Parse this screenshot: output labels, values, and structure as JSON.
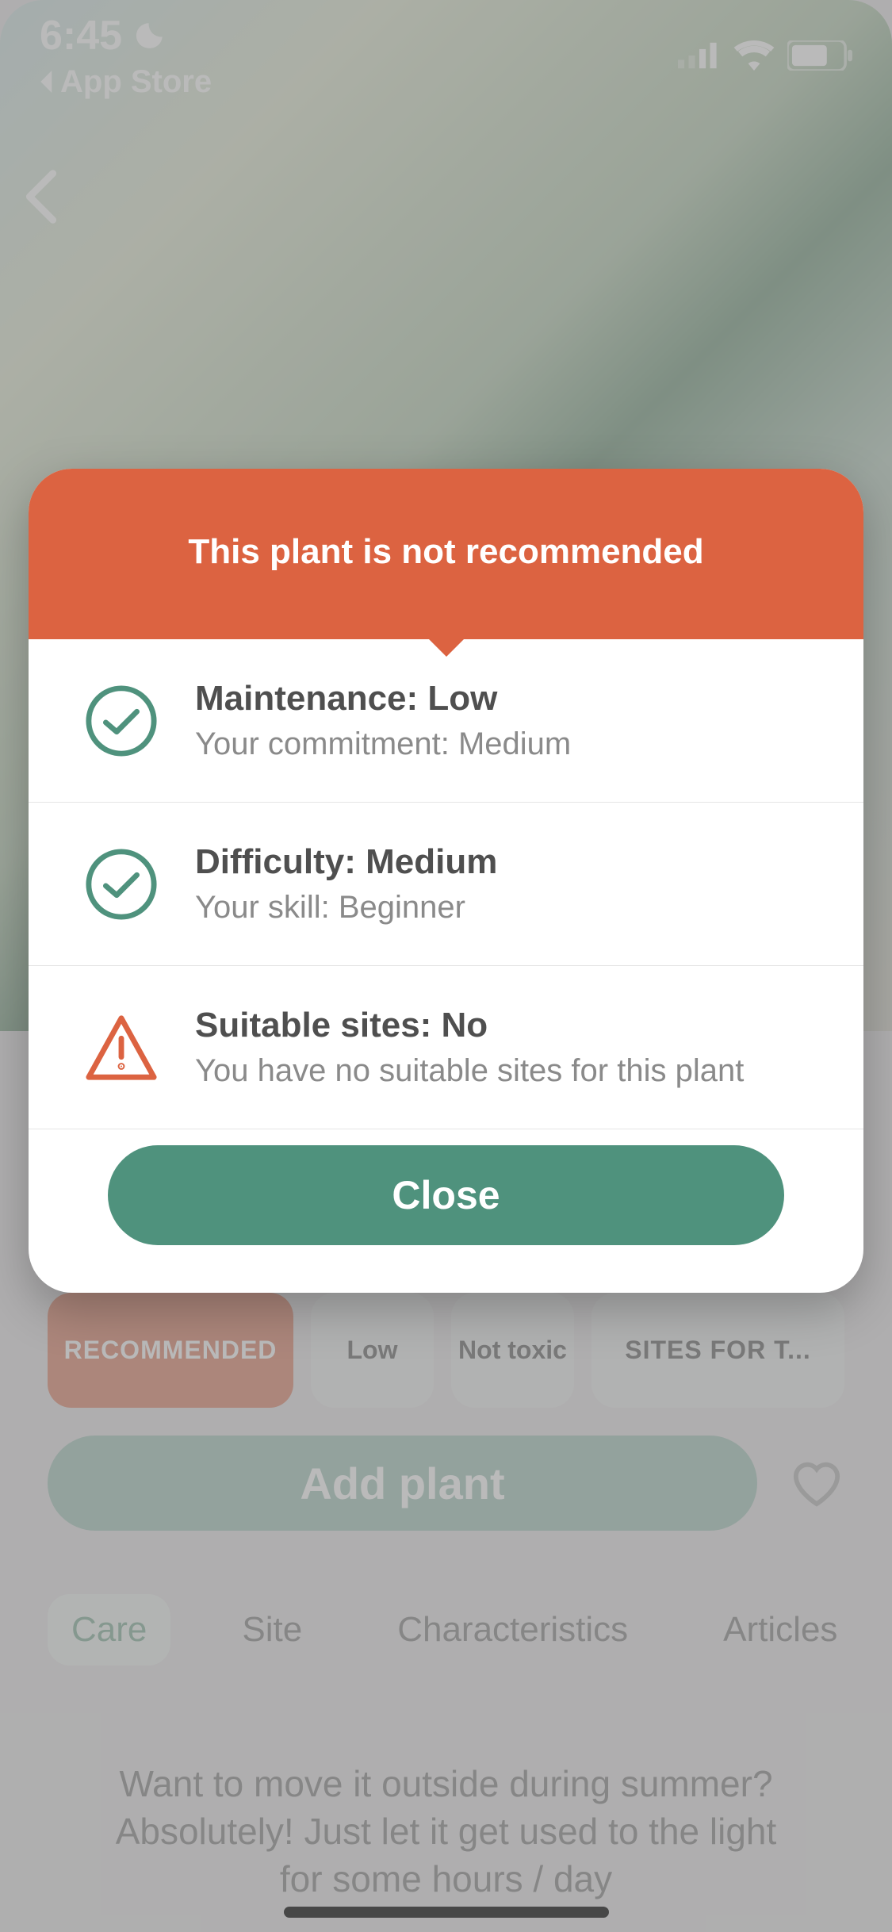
{
  "status": {
    "time": "6:45",
    "back_app": "App Store"
  },
  "background": {
    "recommended_chip": "RECOMMENDED",
    "maintenance_chip": "Low",
    "toxic_chip": "Not toxic",
    "sites_chip": "SITES FOR T...",
    "add_button": "Add plant",
    "tabs": {
      "care": "Care",
      "site": "Site",
      "characteristics": "Characteristics",
      "articles": "Articles"
    },
    "paragraph": "Want to move it outside during summer? Absolutely! Just let it get used to the light for some hours / day"
  },
  "modal": {
    "header": "This plant is not recommended",
    "rows": [
      {
        "icon": "check",
        "title": "Maintenance: Low",
        "sub": "Your commitment: Medium"
      },
      {
        "icon": "check",
        "title": "Difficulty: Medium",
        "sub": "Your skill: Beginner"
      },
      {
        "icon": "warn",
        "title": "Suitable sites: No",
        "sub": "You have no suitable sites for this plant"
      }
    ],
    "close": "Close"
  },
  "colors": {
    "accent_green": "#4f927d",
    "accent_orange": "#dc6341"
  }
}
